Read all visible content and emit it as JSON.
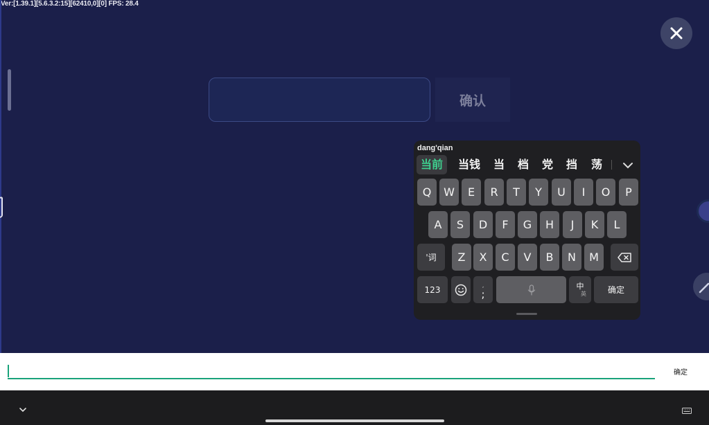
{
  "debug": {
    "text": "Ver:[1.39.1][5.6.3.2:15][62410,0][0] FPS: 28.4"
  },
  "top_form": {
    "input_value": "",
    "confirm_label": "确认"
  },
  "keyboard": {
    "pinyin": "dang'qian",
    "candidates": [
      "当前",
      "当钱",
      "当",
      "档",
      "党",
      "挡",
      "荡"
    ],
    "row1": [
      "Q",
      "W",
      "E",
      "R",
      "T",
      "Y",
      "U",
      "I",
      "O",
      "P"
    ],
    "row2": [
      "A",
      "S",
      "D",
      "F",
      "G",
      "H",
      "J",
      "K",
      "L"
    ],
    "row3_left": "'词",
    "row3": [
      "Z",
      "X",
      "C",
      "V",
      "B",
      "N",
      "M"
    ],
    "num_label": "123",
    "punct_label": ";",
    "punct_sub": ",",
    "lang_label": "中",
    "lang_sub": "英",
    "enter_label": "确定"
  },
  "bottom_input": {
    "value": "",
    "confirm_label": "确定"
  },
  "colors": {
    "background": "#1b1f4a",
    "accent": "#19a37a",
    "candidate_active": "#3ecf8e"
  },
  "icons": {
    "close": "close-icon",
    "expand": "chevron-down-icon",
    "emoji": "emoji-icon",
    "mic": "mic-icon",
    "backspace": "backspace-icon",
    "nav_hide": "chevron-down-icon",
    "nav_keyboard": "keyboard-icon"
  }
}
